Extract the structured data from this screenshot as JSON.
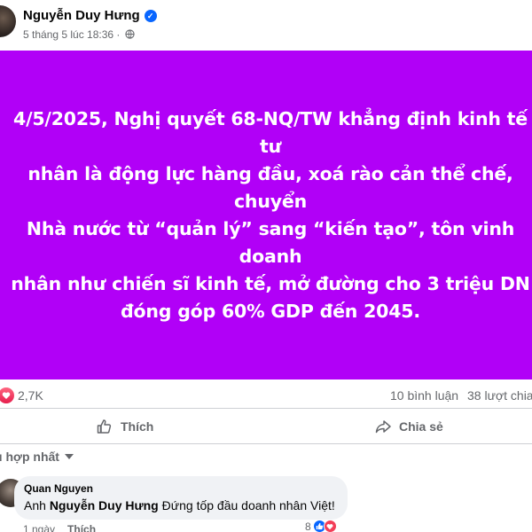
{
  "post": {
    "author": "Nguyễn Duy Hưng",
    "timestamp": "5 tháng 5 lúc 18:36 ·",
    "banner_text": "4/5/2025, Nghị quyết 68-NQ/TW khẳng định kinh tế tư\nnhân là động lực hàng đầu, xoá rào cản thể chế, chuyển\nNhà nước từ “quản lý” sang “kiến tạo”, tôn vinh doanh\nnhân như chiến sĩ kinh tế, mở đường cho 3 triệu DN\nđóng góp 60% GDP đến 2045.",
    "banner_color": "#b100f7"
  },
  "stats": {
    "reactions": "2,7K",
    "comments": "10 bình luận",
    "shares": "38 lượt chia"
  },
  "actions": {
    "like_label": "Thích",
    "share_label": "Chia sẻ"
  },
  "sort": {
    "label": "u hợp nhất"
  },
  "comment": {
    "author": "Quan Nguyen",
    "prefix": "Anh ",
    "mention": "Nguyễn Duy Hưng",
    "text": " Đứng tốp đầu doanh nhân Việt!",
    "reaction_count": "8",
    "time": "1 ngày",
    "reply_label": "Thích"
  },
  "colors": {
    "accent": "#0866ff",
    "love": "#f33e58"
  }
}
